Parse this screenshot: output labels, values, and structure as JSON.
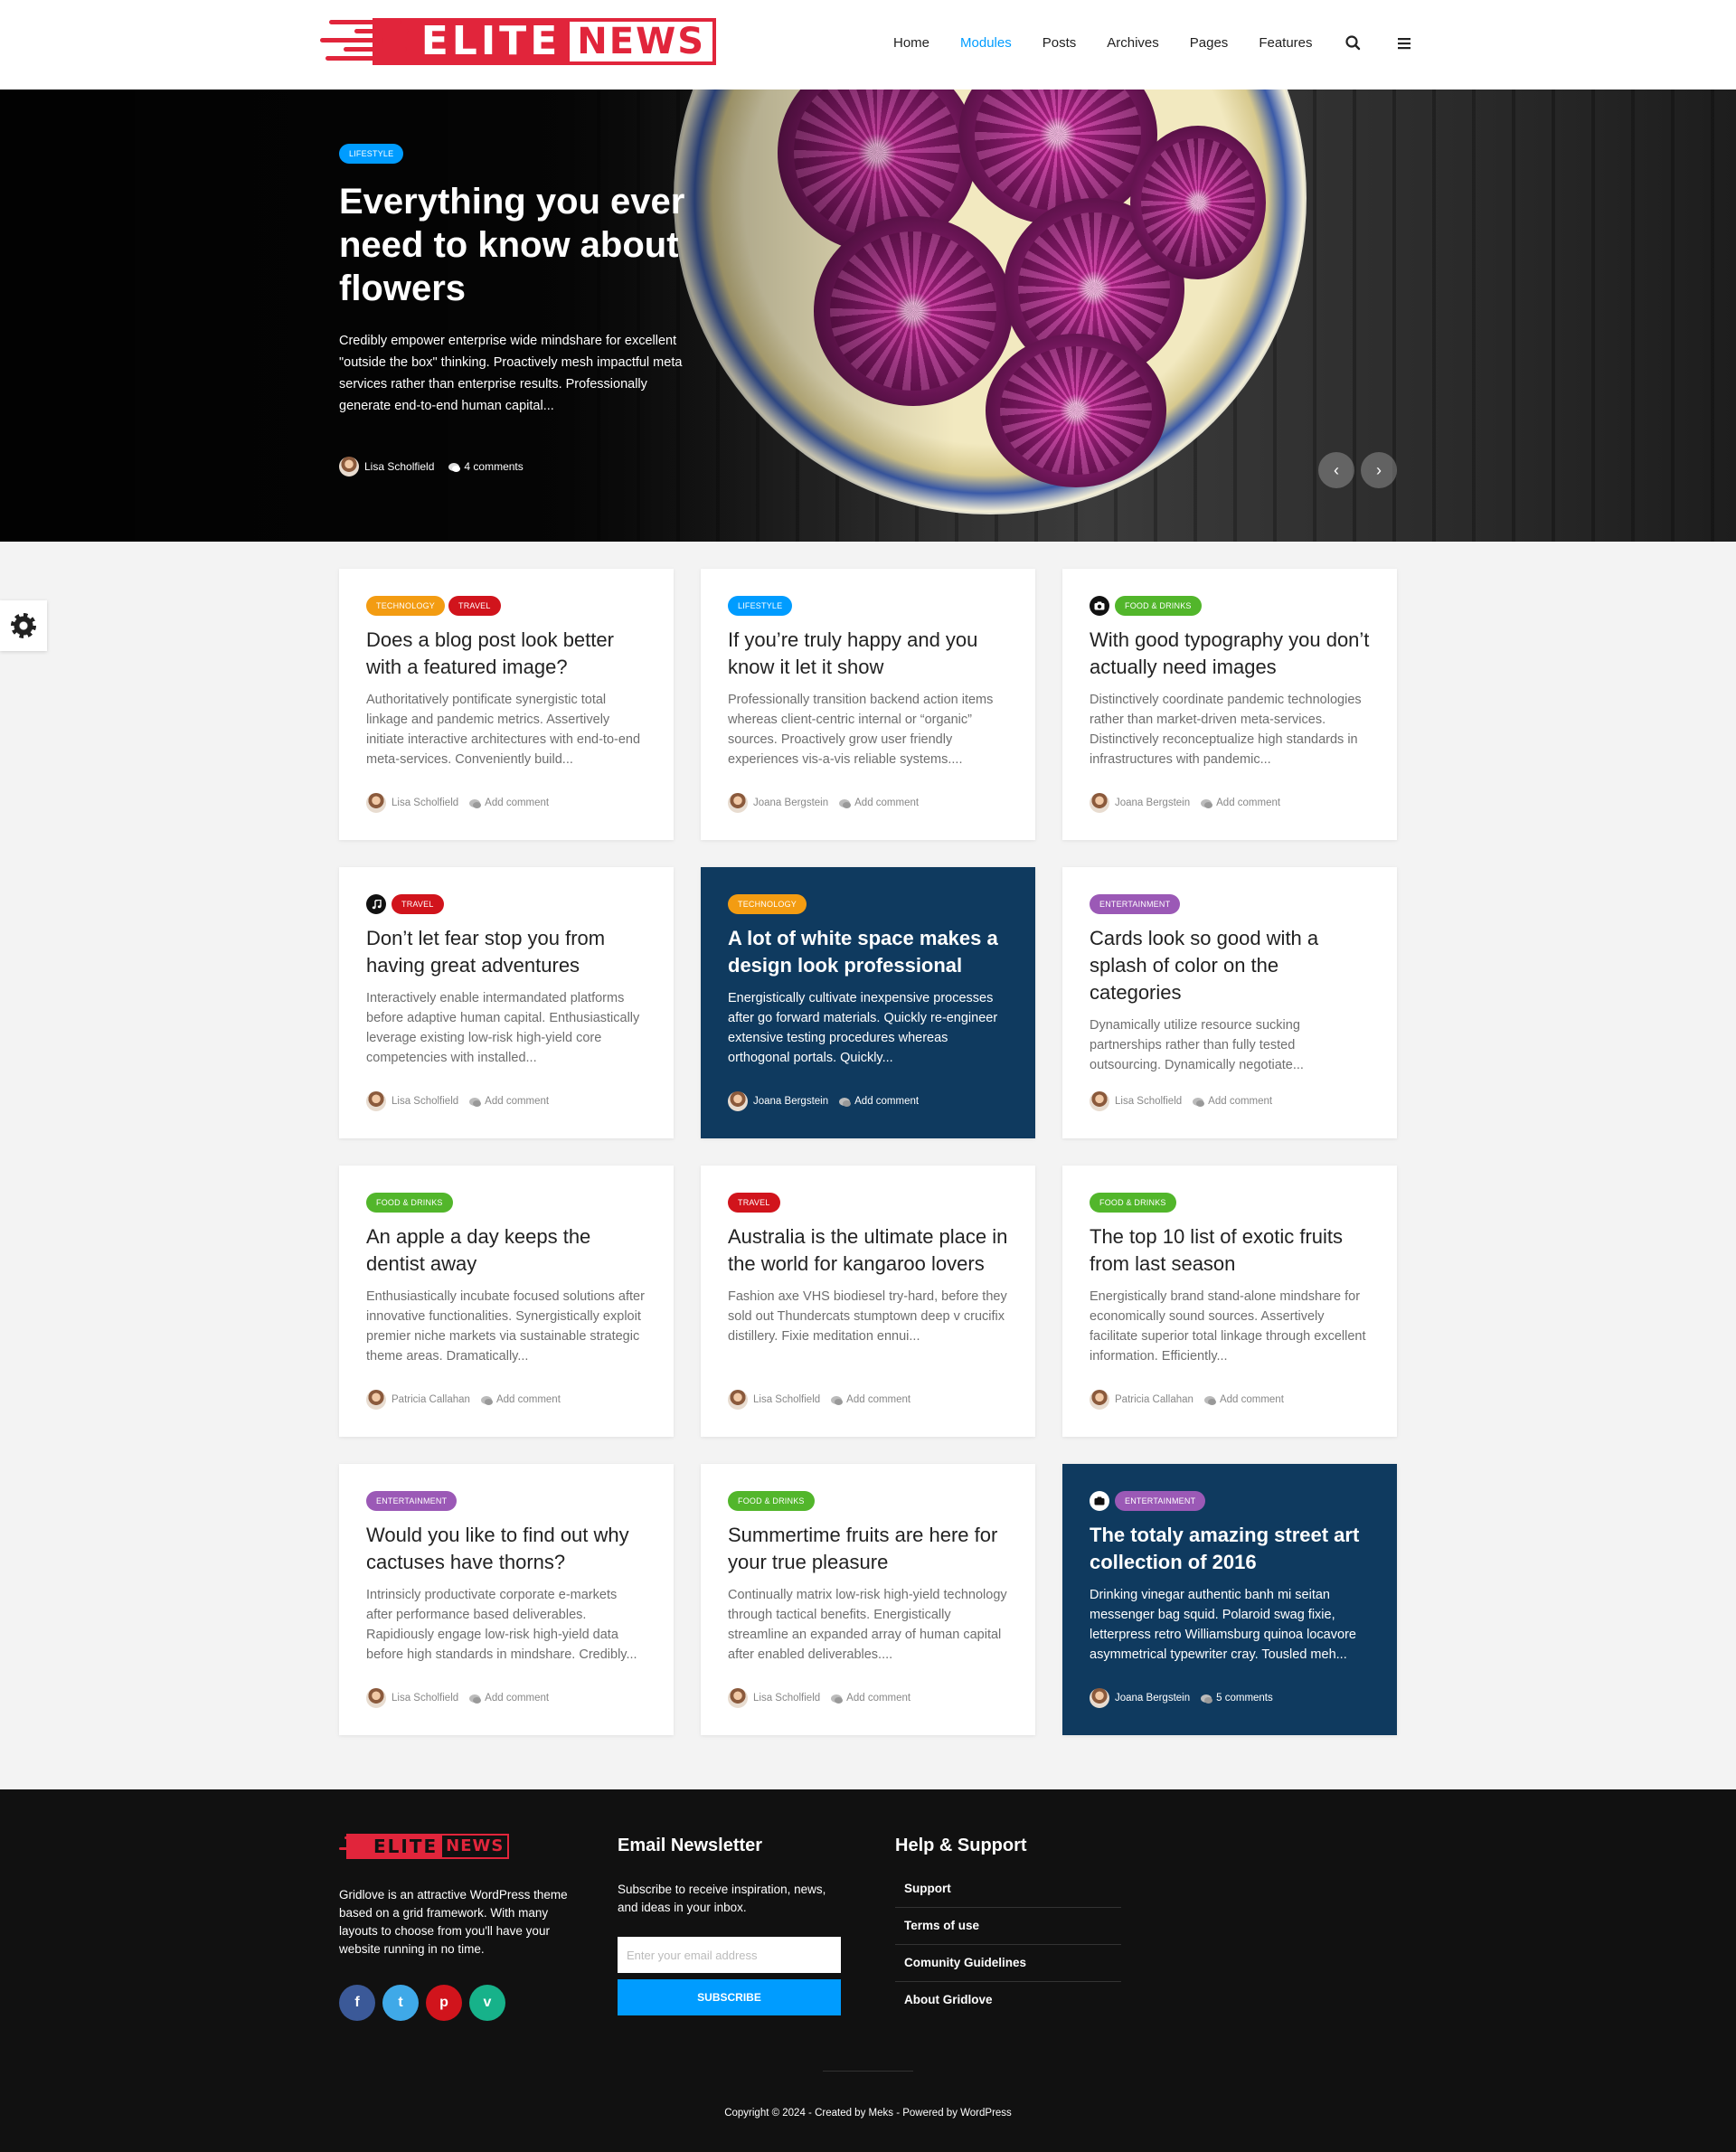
{
  "header": {
    "logo": {
      "word1": "ELITE",
      "word2": "NEWS",
      "color": "#e1253b"
    },
    "nav": [
      {
        "label": "Home",
        "active": false
      },
      {
        "label": "Modules",
        "active": true
      },
      {
        "label": "Posts",
        "active": false
      },
      {
        "label": "Archives",
        "active": false
      },
      {
        "label": "Pages",
        "active": false
      },
      {
        "label": "Features",
        "active": false
      }
    ],
    "icons": [
      "search-icon",
      "hamburger-menu-icon"
    ]
  },
  "hero": {
    "category": "LIFESTYLE",
    "category_color": "#009cff",
    "title": "Everything you ever need to know about flowers",
    "excerpt": "Credibly empower enterprise wide mindshare for excellent \"outside the box\" thinking. Proactively mesh impactful meta services rather than enterprise results. Professionally generate end-to-end human capital...",
    "author": "Lisa Scholfield",
    "comments": "4 comments",
    "prev": "‹",
    "next": "›"
  },
  "settings": {
    "icon": "gear-icon"
  },
  "cards": [
    {
      "categories": [
        {
          "label": "TECHNOLOGY",
          "color": "#f39c12"
        },
        {
          "label": "TRAVEL",
          "color": "#d1141c"
        }
      ],
      "format": "",
      "title": "Does a blog post look better with a featured image?",
      "excerpt": "Authoritatively pontificate synergistic total linkage and pandemic metrics. Assertively initiate interactive architectures with end-to-end meta-services. Conveniently build...",
      "author": "Lisa Scholfield",
      "comments": "Add comment",
      "dark": false
    },
    {
      "categories": [
        {
          "label": "LIFESTYLE",
          "color": "#009cff"
        }
      ],
      "format": "",
      "title": "If you’re truly happy and you know it let it show",
      "excerpt": "Professionally transition backend action items whereas client-centric internal or “organic” sources. Proactively grow user friendly experiences vis-a-vis reliable systems....",
      "author": "Joana Bergstein",
      "comments": "Add comment",
      "dark": false
    },
    {
      "categories": [
        {
          "label": "FOOD & DRINKS",
          "color": "#52b62b"
        }
      ],
      "format": "camera-icon",
      "title": "With good typography you don’t actually need images",
      "excerpt": "Distinctively coordinate pandemic technologies rather than market-driven meta-services. Distinctively reconceptualize high standards in infrastructures with pandemic...",
      "author": "Joana Bergstein",
      "comments": "Add comment",
      "dark": false
    },
    {
      "categories": [
        {
          "label": "TRAVEL",
          "color": "#d1141c"
        }
      ],
      "format": "music-icon",
      "title": "Don’t let fear stop you from having great adventures",
      "excerpt": "Interactively enable intermandated platforms before adaptive human capital. Enthusiastically leverage existing low-risk high-yield core competencies with installed...",
      "author": "Lisa Scholfield",
      "comments": "Add comment",
      "dark": false
    },
    {
      "categories": [
        {
          "label": "TECHNOLOGY",
          "color": "#f39c12"
        }
      ],
      "format": "",
      "title": "A lot of white space makes a design look professional",
      "excerpt": "Energistically cultivate inexpensive processes after go forward materials. Quickly re-engineer extensive testing procedures whereas orthogonal portals. Quickly...",
      "author": "Joana Bergstein",
      "comments": "Add comment",
      "dark": true
    },
    {
      "categories": [
        {
          "label": "ENTERTAINMENT",
          "color": "#9b59b6"
        }
      ],
      "format": "",
      "title": "Cards look so good with a splash of color on the categories",
      "excerpt": "Dynamically utilize resource sucking partnerships rather than fully tested outsourcing. Dynamically negotiate...",
      "author": "Lisa Scholfield",
      "comments": "Add comment",
      "dark": false
    },
    {
      "categories": [
        {
          "label": "FOOD & DRINKS",
          "color": "#52b62b"
        }
      ],
      "format": "",
      "title": "An apple a day keeps the dentist away",
      "excerpt": "Enthusiastically incubate focused solutions after innovative functionalities. Synergistically exploit premier niche markets via sustainable strategic theme areas. Dramatically...",
      "author": "Patricia Callahan",
      "comments": "Add comment",
      "dark": false
    },
    {
      "categories": [
        {
          "label": "TRAVEL",
          "color": "#d1141c"
        }
      ],
      "format": "",
      "title": "Australia is the ultimate place in the world for kangaroo lovers",
      "excerpt": "Fashion axe VHS biodiesel try-hard, before they sold out Thundercats stumptown deep v crucifix distillery. Fixie meditation ennui...",
      "author": "Lisa Scholfield",
      "comments": "Add comment",
      "dark": false
    },
    {
      "categories": [
        {
          "label": "FOOD & DRINKS",
          "color": "#52b62b"
        }
      ],
      "format": "",
      "title": "The top 10 list of exotic fruits from last season",
      "excerpt": "Energistically brand stand-alone mindshare for economically sound sources. Assertively facilitate superior total linkage through excellent information. Efficiently...",
      "author": "Patricia Callahan",
      "comments": "Add comment",
      "dark": false
    },
    {
      "categories": [
        {
          "label": "ENTERTAINMENT",
          "color": "#9b59b6"
        }
      ],
      "format": "",
      "title": "Would you like to find out why cactuses have thorns?",
      "excerpt": "Intrinsicly productivate corporate e-markets after performance based deliverables. Rapidiously engage low-risk high-yield data before high standards in mindshare. Credibly...",
      "author": "Lisa Scholfield",
      "comments": "Add comment",
      "dark": false
    },
    {
      "categories": [
        {
          "label": "FOOD & DRINKS",
          "color": "#52b62b"
        }
      ],
      "format": "",
      "title": "Summertime fruits are here for your true pleasure",
      "excerpt": "Continually matrix low-risk high-yield technology through tactical benefits. Energistically streamline an expanded array of human capital after enabled deliverables....",
      "author": "Lisa Scholfield",
      "comments": "Add comment",
      "dark": false
    },
    {
      "categories": [
        {
          "label": "ENTERTAINMENT",
          "color": "#9b59b6"
        }
      ],
      "format": "camera-icon",
      "title": "The totaly amazing street art collection of 2016",
      "excerpt": "Drinking vinegar authentic banh mi seitan messenger bag squid. Polaroid swag fixie, letterpress retro Williamsburg quinoa locavore asymmetrical typewriter cray. Tousled meh...",
      "author": "Joana Bergstein",
      "comments": "5 comments",
      "dark": true
    }
  ],
  "footer": {
    "logo": {
      "word1": "ELITE",
      "word2": "NEWS"
    },
    "about": "Gridlove is an attractive WordPress theme based on a grid framework. With many layouts to choose from you'll have your website running in no time.",
    "socials": [
      {
        "name": "facebook-icon",
        "glyph": "f",
        "color": "#3b5998"
      },
      {
        "name": "twitter-icon",
        "glyph": "t",
        "color": "#3fa9e8"
      },
      {
        "name": "pinterest-icon",
        "glyph": "p",
        "color": "#d1141c"
      },
      {
        "name": "vine-icon",
        "glyph": "v",
        "color": "#17b28a"
      }
    ],
    "newsletter": {
      "heading": "Email Newsletter",
      "text": "Subscribe to receive inspiration, news, and ideas in your inbox.",
      "placeholder": "Enter your email address",
      "button": "Subscribe"
    },
    "help": {
      "heading": "Help & Support",
      "links": [
        "Support",
        "Terms of use",
        "Comunity Guidelines",
        "About Gridlove"
      ]
    },
    "copyright": "Copyright © 2024 - Created by Meks - Powered by WordPress"
  }
}
